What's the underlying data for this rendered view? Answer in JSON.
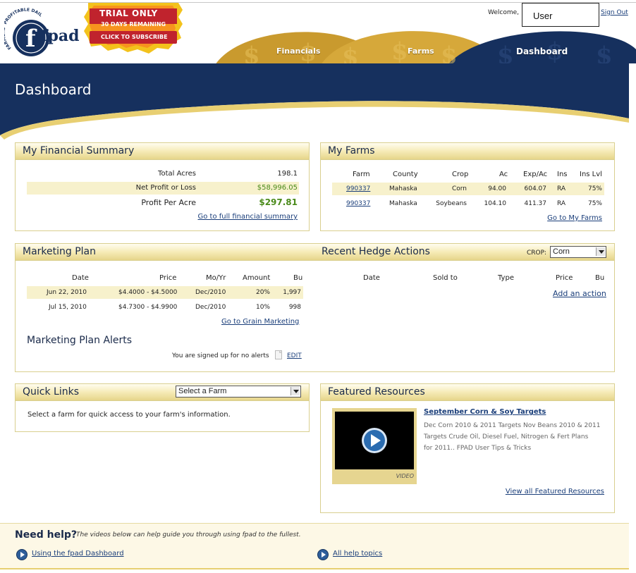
{
  "header": {
    "logo_text": "fpad",
    "logo_arc_text": "FARMERS' PROFITABLE DAILY",
    "trial": {
      "title": "TRIAL ONLY",
      "days": "30 DAYS REMAINING",
      "cta": "CLICK TO SUBSCRIBE"
    },
    "welcome_label": "Welcome,",
    "user_name": "User",
    "signout_label": "Sign Out",
    "tabs": [
      {
        "label": "Financials"
      },
      {
        "label": "Farms"
      },
      {
        "label": "Dashboard"
      }
    ]
  },
  "page_title": "Dashboard",
  "financial_summary": {
    "title": "My Financial Summary",
    "rows": [
      {
        "label": "Total Acres",
        "value": "198.1"
      },
      {
        "label": "Net Profit or Loss",
        "value": "$58,996.05"
      },
      {
        "label": "Profit Per Acre",
        "value": "$297.81"
      }
    ],
    "link": "Go to full financial summary"
  },
  "my_farms": {
    "title": "My Farms",
    "columns": [
      "Farm",
      "County",
      "Crop",
      "Ac",
      "Exp/Ac",
      "Ins",
      "Ins Lvl"
    ],
    "rows": [
      {
        "farm": "990337",
        "county": "Mahaska",
        "crop": "Corn",
        "ac": "94.00",
        "exp": "604.07",
        "ins": "RA",
        "lvl": "75%"
      },
      {
        "farm": "990337",
        "county": "Mahaska",
        "crop": "Soybeans",
        "ac": "104.10",
        "exp": "411.37",
        "ins": "RA",
        "lvl": "75%"
      }
    ],
    "link": "Go to My Farms"
  },
  "marketing_plan": {
    "title": "Marketing Plan",
    "columns": [
      "Date",
      "Price",
      "Mo/Yr",
      "Amount",
      "Bu"
    ],
    "rows": [
      {
        "date": "Jun 22, 2010",
        "price": "$4.4000 - $4.5000",
        "moyr": "Dec/2010",
        "amount": "20%",
        "bu": "1,997"
      },
      {
        "date": "Jul 15, 2010",
        "price": "$4.7300 - $4.9900",
        "moyr": "Dec/2010",
        "amount": "10%",
        "bu": "998"
      }
    ],
    "link": "Go to Grain Marketing",
    "alerts_title": "Marketing Plan Alerts",
    "alerts_text": "You are signed up for no alerts",
    "alerts_edit": "EDIT"
  },
  "hedge": {
    "title": "Recent Hedge Actions",
    "crop_label": "CROP:",
    "crop_value": "Corn",
    "columns": [
      "Date",
      "Sold to",
      "Type",
      "Price",
      "Bu"
    ],
    "link": "Add an action"
  },
  "quick_links": {
    "title": "Quick Links",
    "select_value": "Select a Farm",
    "text": "Select a farm for quick access to your farm's information."
  },
  "featured": {
    "title": "Featured Resources",
    "video_label": "VIDEO",
    "item_title": "September Corn & Soy Targets",
    "item_desc_1": "Dec Corn 2010 & 2011 Targets Nov Beans 2010 & 2011",
    "item_desc_2": "Targets Crude Oil, Diesel Fuel, Nitrogen & Fert Plans",
    "item_desc_3": "for 2011.. FPAD User Tips & Tricks",
    "link": "View all Featured Resources"
  },
  "help": {
    "title": "Need help?",
    "subtitle": "The videos below can help guide you through using fpad to the fullest.",
    "link1": "Using the fpad Dashboard",
    "link2": "All help topics"
  },
  "colors": {
    "navy": "#16305e",
    "gold": "#d9b545",
    "green": "#4a8a1a",
    "link": "#1a3e7a"
  }
}
